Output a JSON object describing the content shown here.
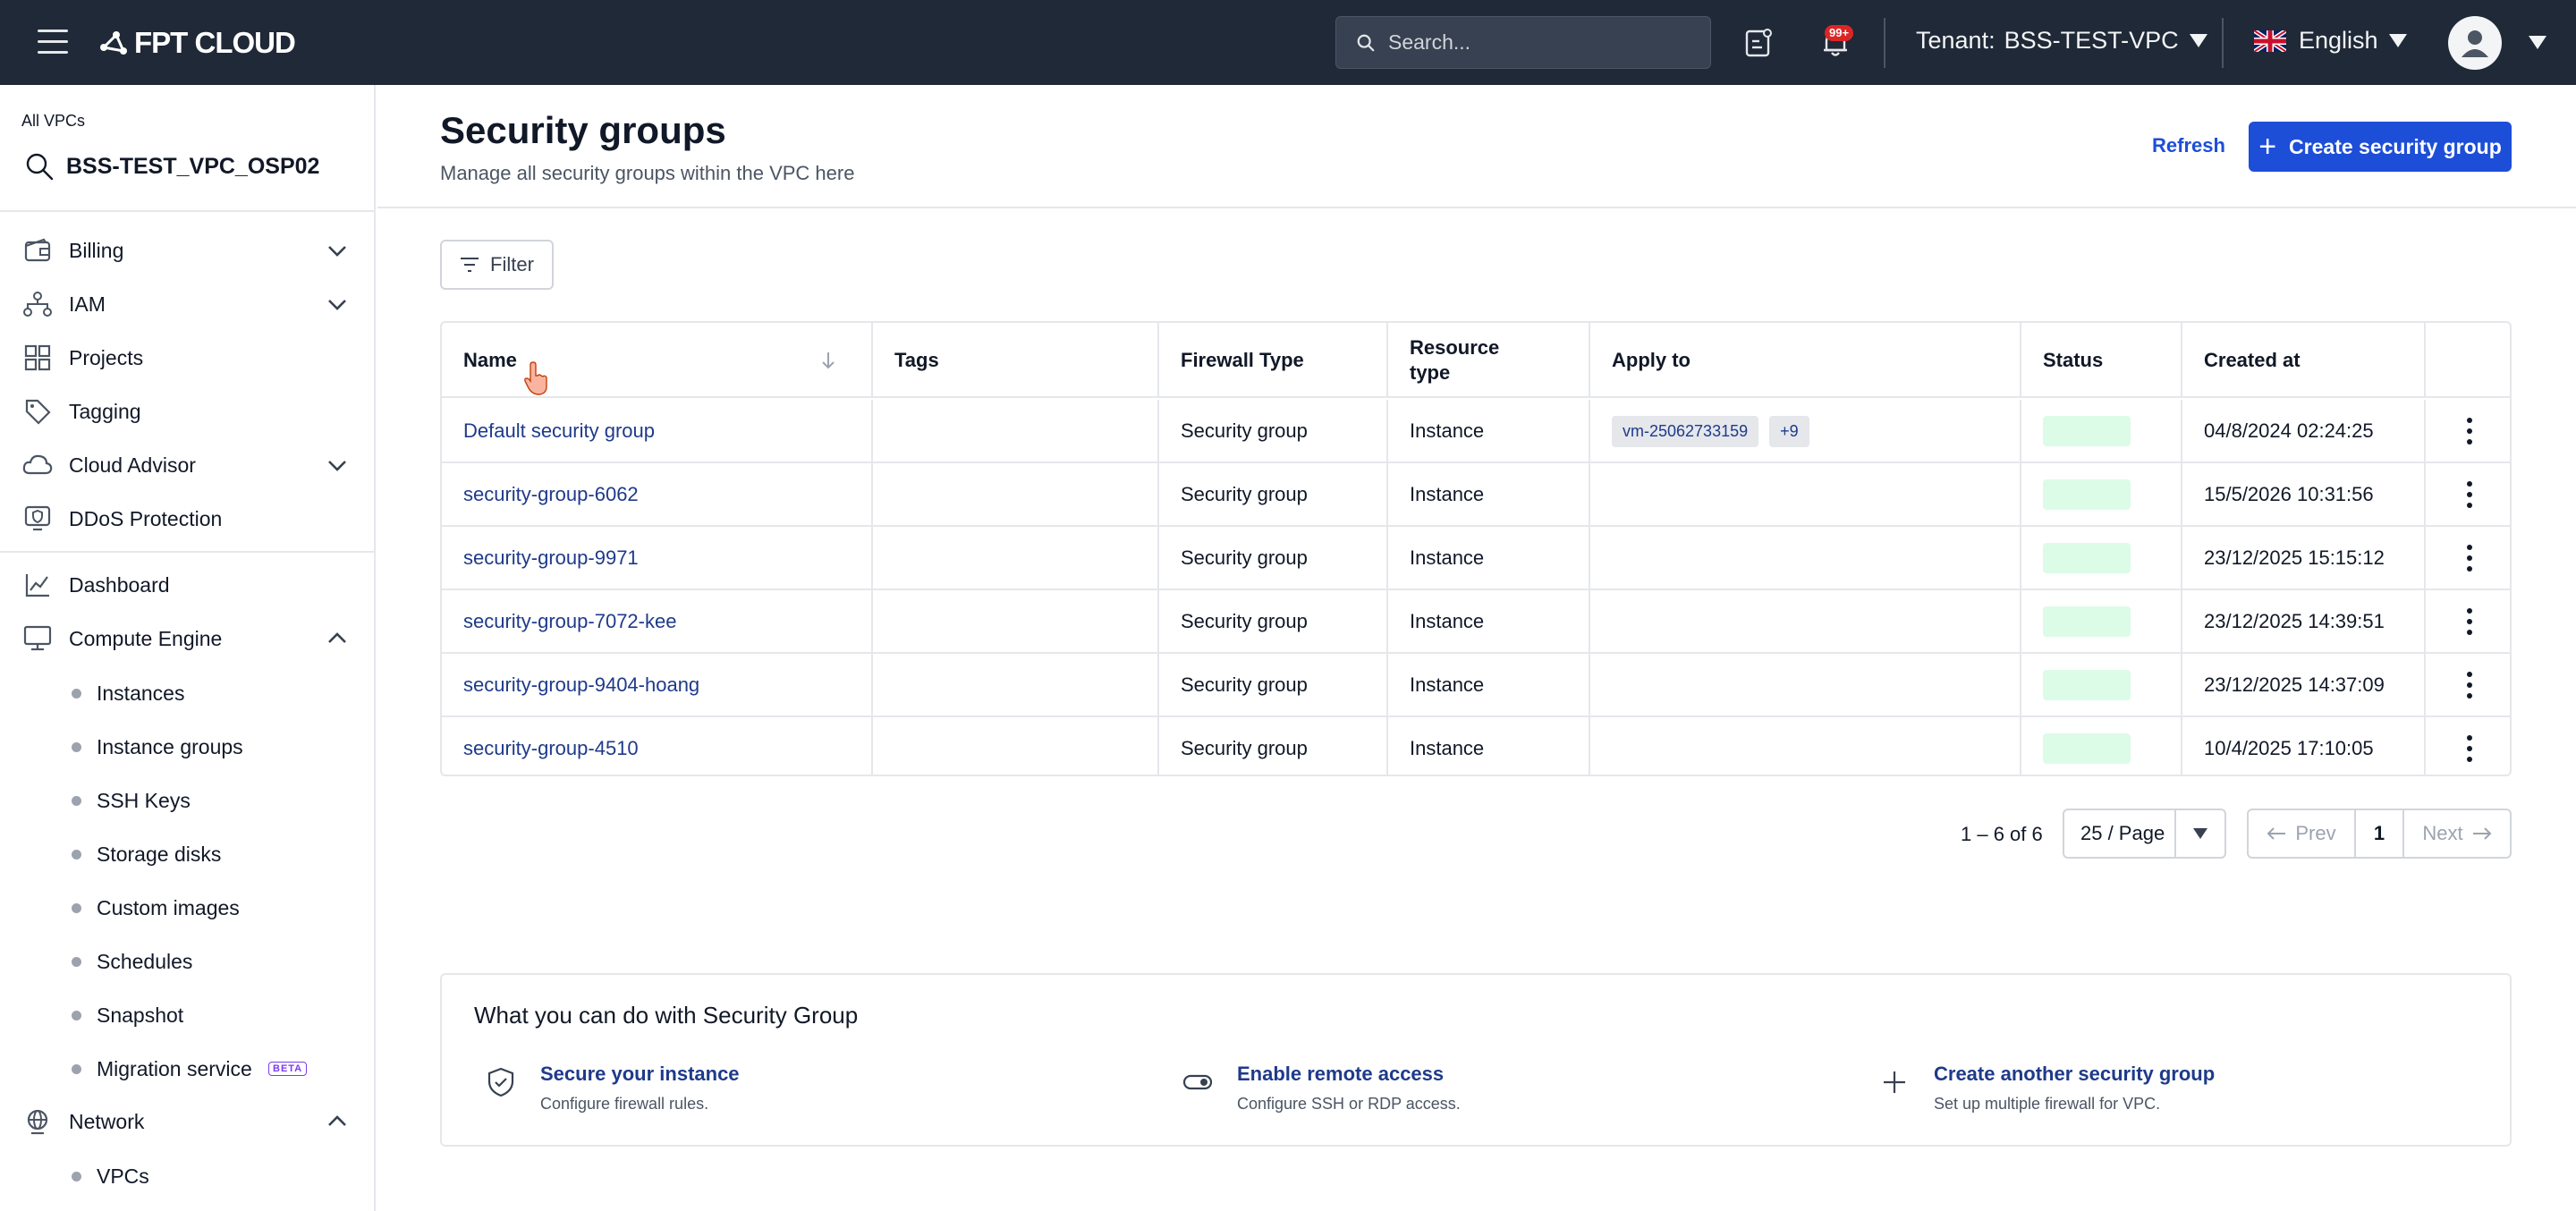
{
  "topbar": {
    "brand": "FPT CLOUD",
    "search_placeholder": "Search...",
    "notification_badge": "99+",
    "tenant_label": "Tenant:",
    "tenant_value": "BSS-TEST-VPC",
    "language": "English"
  },
  "sidebar": {
    "all_vpcs_label": "All VPCs",
    "vpc_name": "BSS-TEST_VPC_OSP02",
    "items": {
      "billing": "Billing",
      "iam": "IAM",
      "projects": "Projects",
      "tagging": "Tagging",
      "cloud_advisor": "Cloud Advisor",
      "ddos": "DDoS Protection",
      "dashboard": "Dashboard",
      "compute_engine": "Compute Engine",
      "network": "Network"
    },
    "compute_sub": {
      "instances": "Instances",
      "instance_groups": "Instance groups",
      "ssh_keys": "SSH Keys",
      "storage_disks": "Storage disks",
      "custom_images": "Custom images",
      "schedules": "Schedules",
      "snapshot": "Snapshot",
      "migration_service": "Migration service",
      "beta": "BETA"
    },
    "network_sub": {
      "vpcs": "VPCs"
    }
  },
  "main": {
    "title": "Security groups",
    "subtitle": "Manage all security groups within the VPC here",
    "refresh_label": "Refresh",
    "create_label": "Create security group",
    "filter_label": "Filter"
  },
  "table": {
    "headers": {
      "name": "Name",
      "tags": "Tags",
      "firewall_type": "Firewall Type",
      "resource_type_1": "Resource",
      "resource_type_2": "type",
      "apply_to": "Apply to",
      "status": "Status",
      "created_at": "Created at"
    },
    "rows": [
      {
        "name": "Default security group",
        "firewall_type": "Security group",
        "resource_type": "Instance",
        "apply_chip": "vm-25062733159",
        "apply_more": "+9",
        "created_at": "04/8/2024 02:24:25"
      },
      {
        "name": "security-group-6062",
        "firewall_type": "Security group",
        "resource_type": "Instance",
        "created_at": "15/5/2026 10:31:56"
      },
      {
        "name": "security-group-9971",
        "firewall_type": "Security group",
        "resource_type": "Instance",
        "created_at": "23/12/2025 15:15:12"
      },
      {
        "name": "security-group-7072-kee",
        "firewall_type": "Security group",
        "resource_type": "Instance",
        "created_at": "23/12/2025 14:39:51"
      },
      {
        "name": "security-group-9404-hoang",
        "firewall_type": "Security group",
        "resource_type": "Instance",
        "created_at": "23/12/2025 14:37:09"
      },
      {
        "name": "security-group-4510",
        "firewall_type": "Security group",
        "resource_type": "Instance",
        "created_at": "10/4/2025 17:10:05"
      }
    ]
  },
  "pagination": {
    "range": "1 – 6 of 6",
    "page_size": "25 / Page",
    "prev": "Prev",
    "current": "1",
    "next": "Next"
  },
  "help": {
    "title": "What you can do with Security Group",
    "items": [
      {
        "title": "Secure your instance",
        "desc": "Configure firewall rules."
      },
      {
        "title": "Enable remote access",
        "desc": "Configure SSH or RDP access."
      },
      {
        "title": "Create another security group",
        "desc": "Set up multiple firewall for VPC."
      }
    ]
  },
  "colors": {
    "topbar_bg": "#1f2937",
    "primary": "#1d4ed8",
    "link": "#1e3a8a",
    "status_active": "#dcfce7"
  }
}
